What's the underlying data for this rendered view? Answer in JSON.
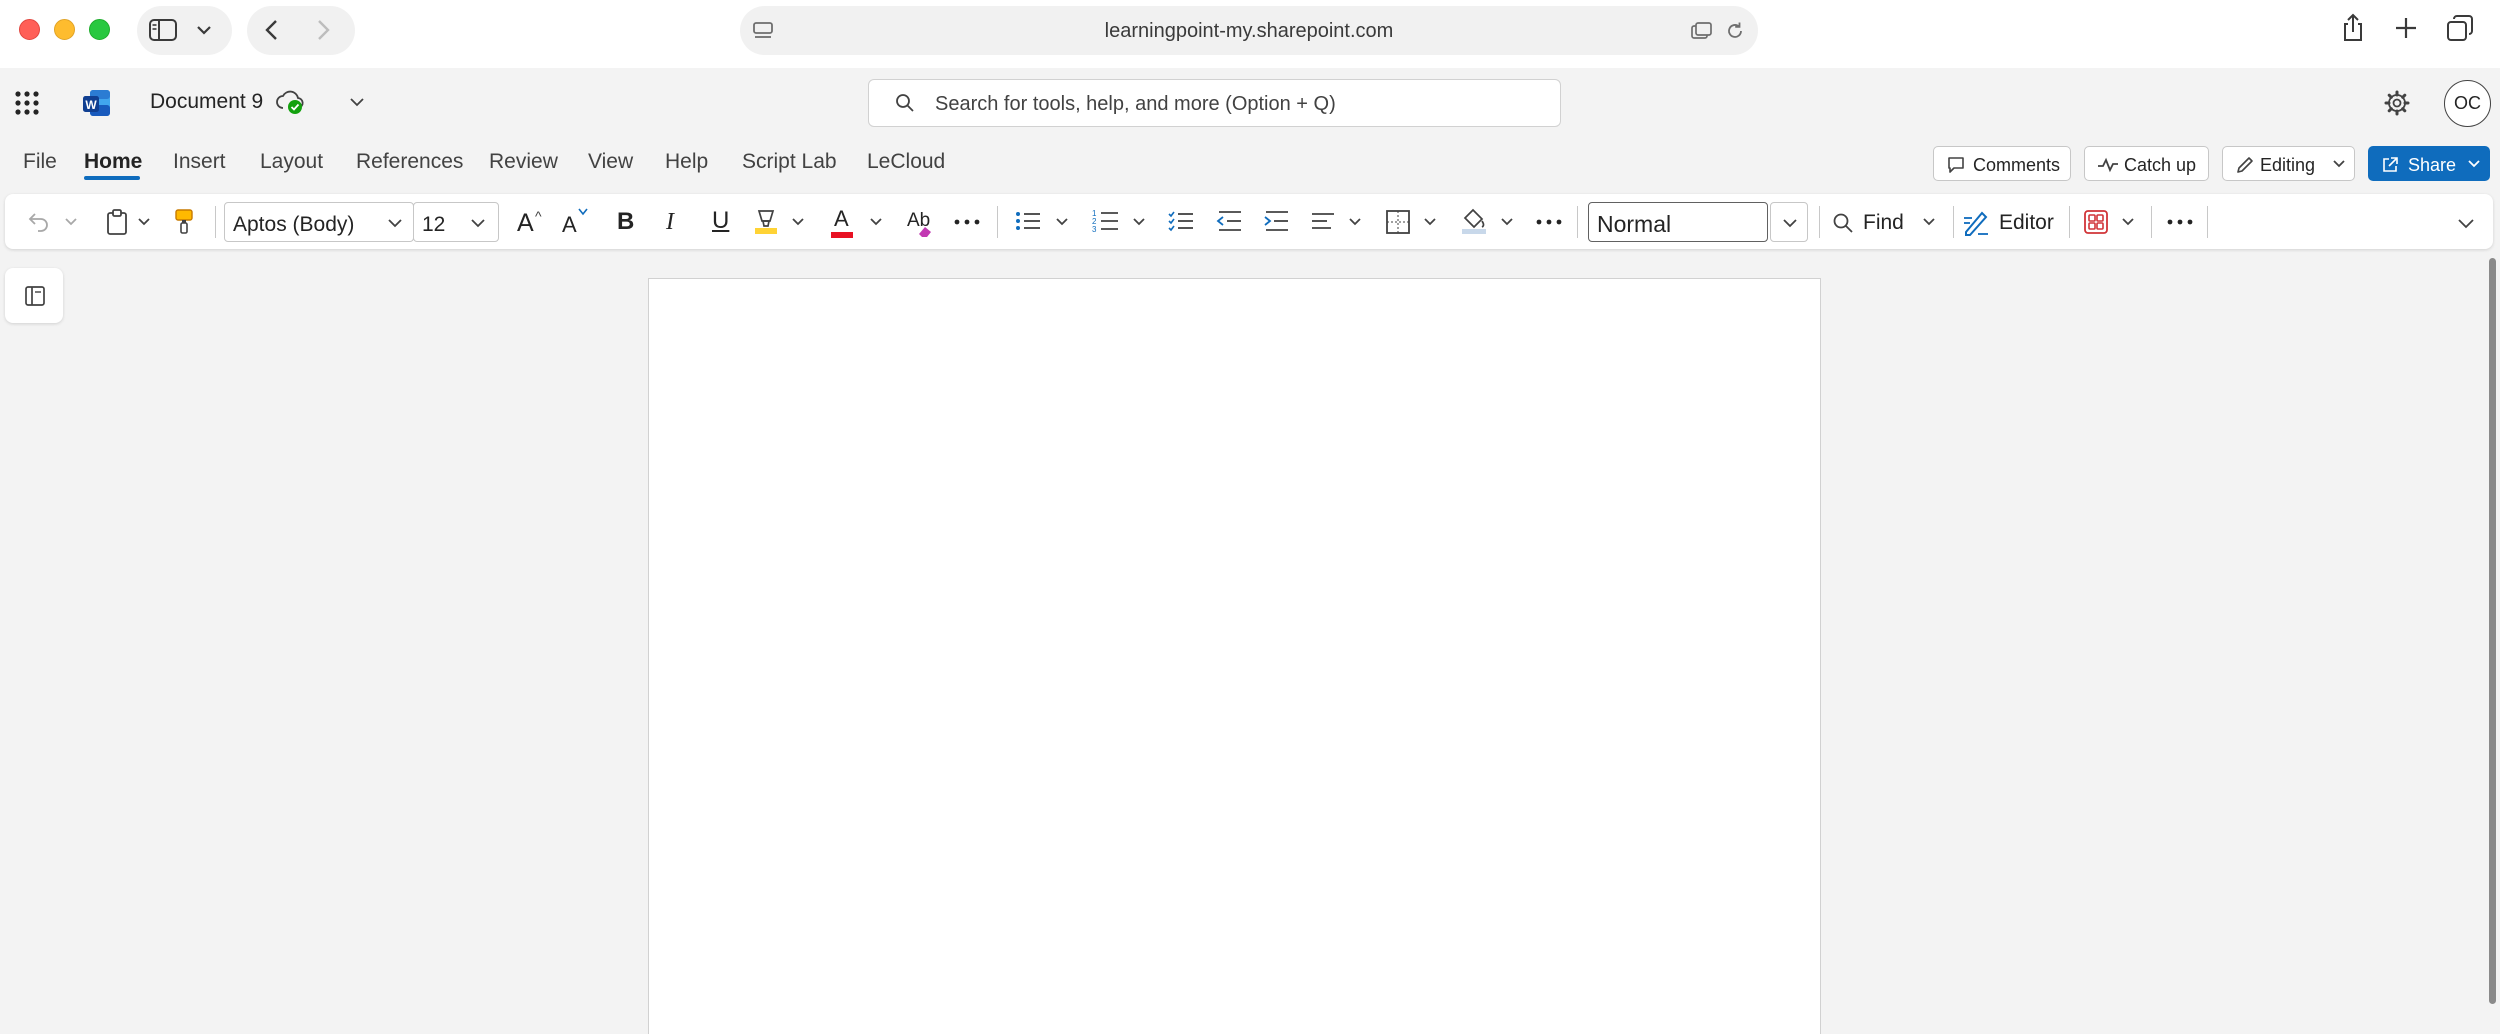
{
  "browser": {
    "url": "learningpoint-my.sharepoint.com",
    "icons": [
      "close-window",
      "minimize-window",
      "maximize-window",
      "sidebar",
      "chevron-down",
      "back",
      "forward",
      "page-menu",
      "tab-overview",
      "reload",
      "share",
      "new-tab",
      "show-tabs"
    ]
  },
  "header": {
    "app_icon": "word-logo",
    "document_title": "Document 9",
    "save_status_icon": "cloud-check",
    "search_placeholder": "Search for tools, help, and more (Option + Q)",
    "avatar_initials": "OC"
  },
  "tabs": [
    {
      "label": "File",
      "active": false
    },
    {
      "label": "Home",
      "active": true
    },
    {
      "label": "Insert",
      "active": false
    },
    {
      "label": "Layout",
      "active": false
    },
    {
      "label": "References",
      "active": false
    },
    {
      "label": "Review",
      "active": false
    },
    {
      "label": "View",
      "active": false
    },
    {
      "label": "Help",
      "active": false
    },
    {
      "label": "Script Lab",
      "active": false
    },
    {
      "label": "LeCloud",
      "active": false
    }
  ],
  "header_buttons": {
    "comments": "Comments",
    "catch_up": "Catch up",
    "editing": "Editing",
    "share": "Share"
  },
  "toolbar": {
    "font_name": "Aptos (Body)",
    "font_size": "12",
    "style": "Normal",
    "find": "Find",
    "editor": "Editor",
    "grow_font_glyph": "A",
    "shrink_font_glyph": "A",
    "bold_glyph": "B",
    "italic_glyph": "I",
    "underline_glyph": "U",
    "font_color_glyph": "A",
    "clear_format_glyph": "Ab"
  },
  "colors": {
    "accent": "#0f6cbd",
    "font_color_bar": "#e81123",
    "highlight": "#ffd335",
    "addins": "#d13438",
    "cloud_check": "#13a10e"
  }
}
